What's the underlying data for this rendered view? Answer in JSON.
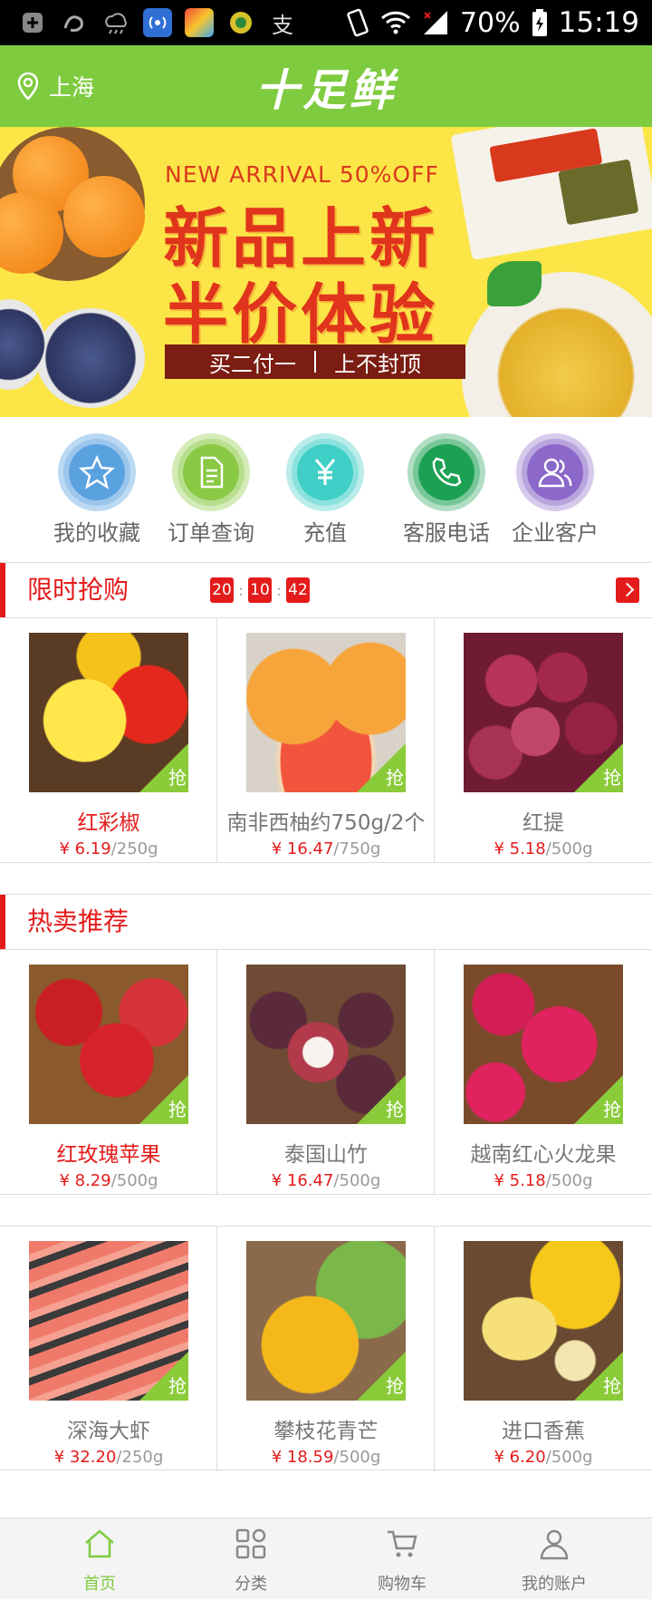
{
  "status_bar": {
    "battery": "70%",
    "time": "15:19",
    "icons": [
      "add-icon",
      "uc-icon",
      "weather-icon",
      "hotspot-icon",
      "app-icon",
      "app-icon",
      "alipay-icon"
    ]
  },
  "header": {
    "location": "上海",
    "brand": "十足鲜"
  },
  "banner": {
    "subtitle": "NEW ARRIVAL 50%OFF",
    "title_line1": "新品上新",
    "title_line2": "半价体验",
    "strip_left": "买二付一",
    "strip_right": "上不封顶"
  },
  "quick_nav": [
    {
      "label": "我的收藏",
      "icon": "star-icon",
      "color": "#5aa1e0"
    },
    {
      "label": "订单查询",
      "icon": "document-icon",
      "color": "#89c944"
    },
    {
      "label": "充值",
      "icon": "yen-icon",
      "color": "#3fcfc6"
    },
    {
      "label": "客服电话",
      "icon": "phone-icon",
      "color": "#1ca154"
    },
    {
      "label": "企业客户",
      "icon": "users-icon",
      "color": "#8b68c9"
    }
  ],
  "flash_sale": {
    "title": "限时抢购",
    "timer": [
      "20",
      "10",
      "42"
    ],
    "products": [
      {
        "name": "红彩椒",
        "price": "¥ 6.19",
        "unit": "/250g",
        "badge": "抢"
      },
      {
        "name": "南非西柚约750g/2个",
        "price": "¥ 16.47",
        "unit": "/750g",
        "badge": "抢"
      },
      {
        "name": "红提",
        "price": "¥ 5.18",
        "unit": "/500g",
        "badge": "抢"
      }
    ]
  },
  "hot": {
    "title": "热卖推荐",
    "products": [
      {
        "name": "红玫瑰苹果",
        "price": "¥ 8.29",
        "unit": "/500g",
        "badge": "抢"
      },
      {
        "name": "泰国山竹",
        "price": "¥ 16.47",
        "unit": "/500g",
        "badge": "抢"
      },
      {
        "name": "越南红心火龙果",
        "price": "¥ 5.18",
        "unit": "/500g",
        "badge": "抢"
      },
      {
        "name": "深海大虾",
        "price": "¥ 32.20",
        "unit": "/250g",
        "badge": "抢"
      },
      {
        "name": "攀枝花青芒",
        "price": "¥ 18.59",
        "unit": "/500g",
        "badge": "抢"
      },
      {
        "name": "进口香蕉",
        "price": "¥ 6.20",
        "unit": "/500g",
        "badge": "抢"
      }
    ]
  },
  "tabbar": [
    {
      "label": "首页",
      "icon": "home-icon",
      "active": true
    },
    {
      "label": "分类",
      "icon": "grid-icon",
      "active": false
    },
    {
      "label": "购物车",
      "icon": "cart-icon",
      "active": false
    },
    {
      "label": "我的账户",
      "icon": "user-icon",
      "active": false
    }
  ],
  "colors": {
    "brand_green": "#7fcb3f",
    "accent_red": "#e41b1b",
    "banner_yellow": "#fbe547"
  }
}
